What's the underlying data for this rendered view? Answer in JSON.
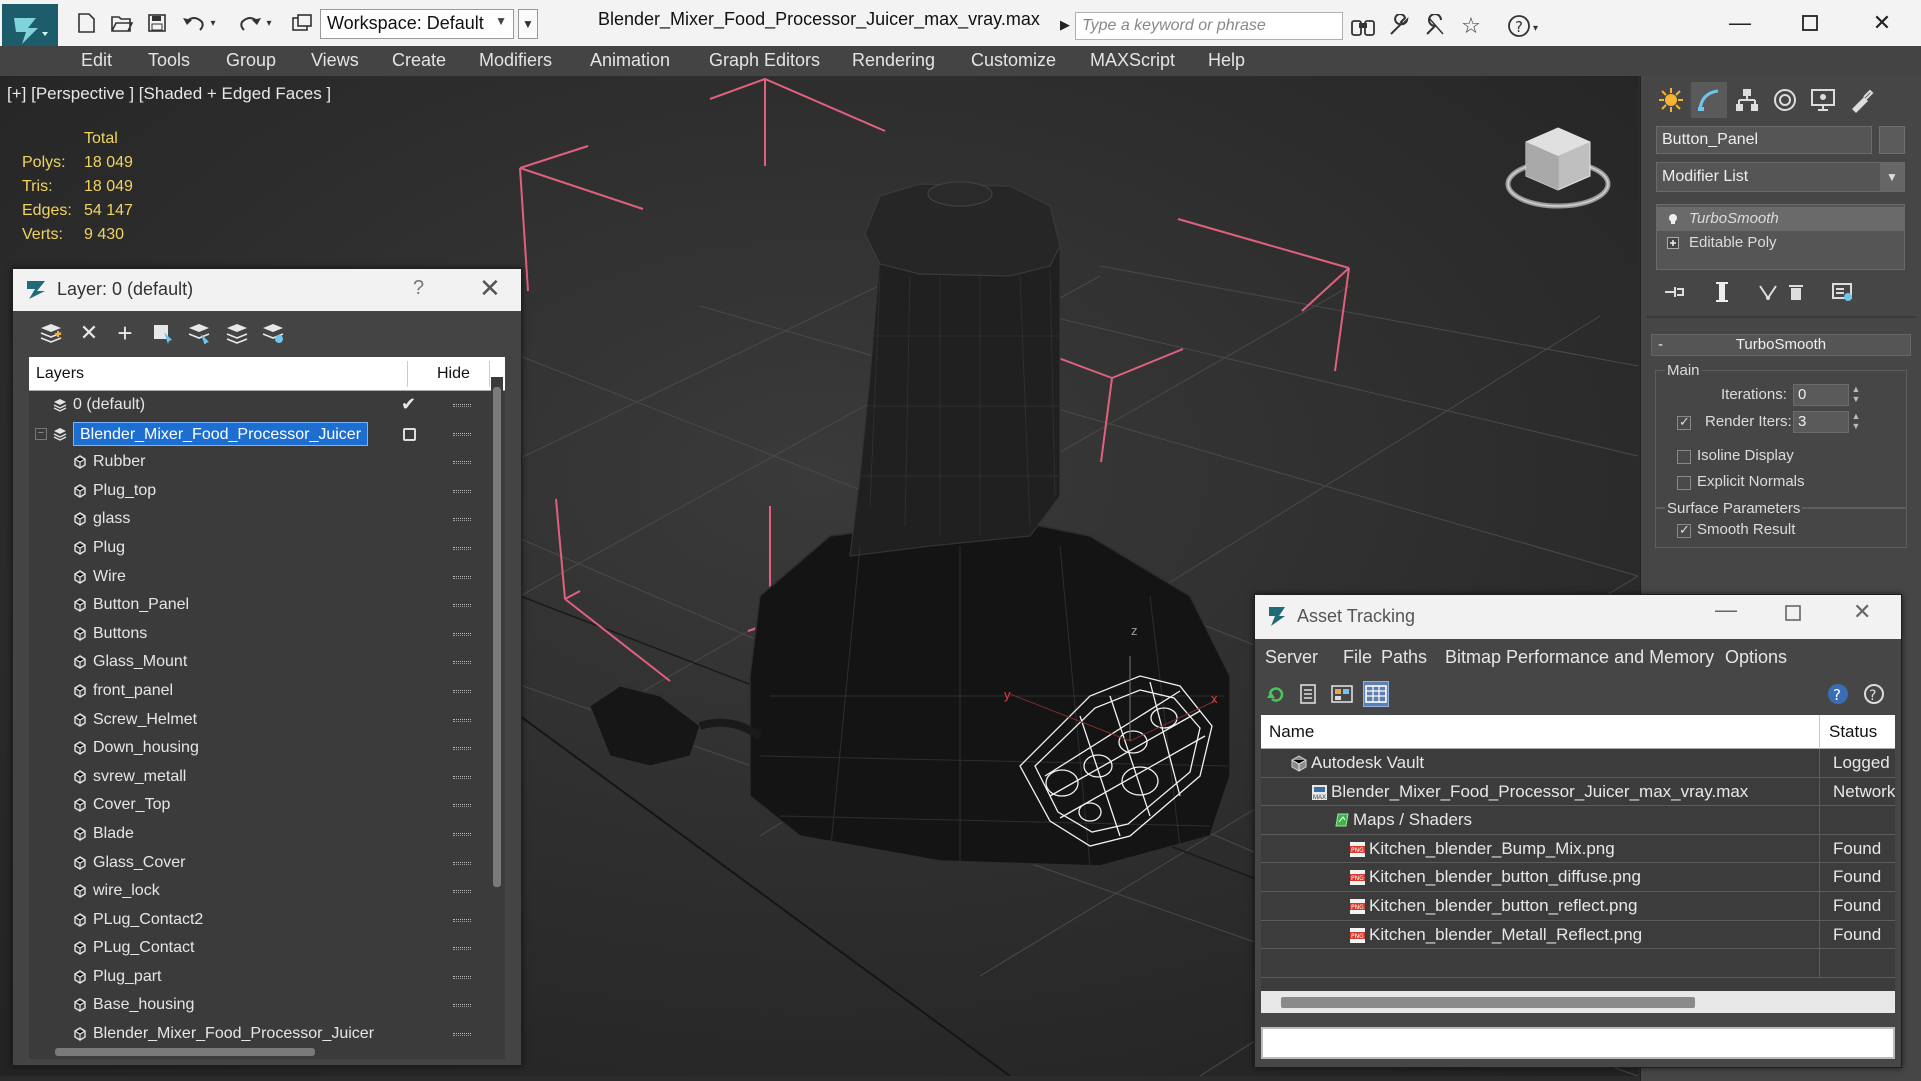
{
  "titlebar": {
    "workspace_label": "Workspace: Default",
    "file_title": "Blender_Mixer_Food_Processor_Juicer_max_vray.max",
    "search_placeholder": "Type a keyword or phrase"
  },
  "menu": [
    "Edit",
    "Tools",
    "Group",
    "Views",
    "Create",
    "Modifiers",
    "Animation",
    "Graph Editors",
    "Rendering",
    "Customize",
    "MAXScript",
    "Help"
  ],
  "viewport": {
    "label": "[+] [Perspective ] [Shaded + Edged Faces ]",
    "stats_header": "Total",
    "stats": [
      {
        "key": "Polys:",
        "value": "18 049"
      },
      {
        "key": "Tris:",
        "value": "18 049"
      },
      {
        "key": "Edges:",
        "value": "54 147"
      },
      {
        "key": "Verts:",
        "value": "9 430"
      }
    ],
    "axis_labels": {
      "x": "x",
      "y": "y",
      "z": "z"
    }
  },
  "command_panel": {
    "object_name": "Button_Panel",
    "modifier_list": "Modifier List",
    "stack": [
      "TurboSmooth",
      "Editable Poly"
    ],
    "rollout_title": "TurboSmooth",
    "main_group": "Main",
    "iterations_label": "Iterations:",
    "iterations_value": "0",
    "render_iters_label": "Render Iters:",
    "render_iters_value": "3",
    "render_iters_checked": true,
    "isoline_label": "Isoline Display",
    "explicit_normals_label": "Explicit Normals",
    "surface_group": "Surface Parameters",
    "smooth_result_label": "Smooth Result",
    "smooth_result_checked": true
  },
  "layer_explorer": {
    "title": "Layer: 0 (default)",
    "help": "?",
    "col_layers": "Layers",
    "col_hide": "Hide",
    "rows": [
      {
        "name": "0 (default)",
        "level": 0,
        "type": "layer"
      },
      {
        "name": "Blender_Mixer_Food_Processor_Juicer",
        "level": 0,
        "type": "layer-selected"
      },
      {
        "name": "Rubber",
        "level": 1,
        "type": "object"
      },
      {
        "name": "Plug_top",
        "level": 1,
        "type": "object"
      },
      {
        "name": "glass",
        "level": 1,
        "type": "object"
      },
      {
        "name": "Plug",
        "level": 1,
        "type": "object"
      },
      {
        "name": "Wire",
        "level": 1,
        "type": "object"
      },
      {
        "name": "Button_Panel",
        "level": 1,
        "type": "object"
      },
      {
        "name": "Buttons",
        "level": 1,
        "type": "object"
      },
      {
        "name": "Glass_Mount",
        "level": 1,
        "type": "object"
      },
      {
        "name": "front_panel",
        "level": 1,
        "type": "object"
      },
      {
        "name": "Screw_Helmet",
        "level": 1,
        "type": "object"
      },
      {
        "name": "Down_housing",
        "level": 1,
        "type": "object"
      },
      {
        "name": "svrew_metall",
        "level": 1,
        "type": "object"
      },
      {
        "name": "Cover_Top",
        "level": 1,
        "type": "object"
      },
      {
        "name": "Blade",
        "level": 1,
        "type": "object"
      },
      {
        "name": "Glass_Cover",
        "level": 1,
        "type": "object"
      },
      {
        "name": "wire_lock",
        "level": 1,
        "type": "object"
      },
      {
        "name": "PLug_Contact2",
        "level": 1,
        "type": "object"
      },
      {
        "name": "PLug_Contact",
        "level": 1,
        "type": "object"
      },
      {
        "name": "Plug_part",
        "level": 1,
        "type": "object"
      },
      {
        "name": "Base_housing",
        "level": 1,
        "type": "object"
      },
      {
        "name": "Blender_Mixer_Food_Processor_Juicer",
        "level": 1,
        "type": "object"
      }
    ]
  },
  "asset_tracking": {
    "title": "Asset Tracking",
    "menu": [
      "Server",
      "File",
      "Paths",
      "Bitmap Performance and Memory",
      "Options"
    ],
    "col_name": "Name",
    "col_status": "Status",
    "rows": [
      {
        "name": "Autodesk Vault",
        "status": "Logged O",
        "level": 0,
        "icon": "vault"
      },
      {
        "name": "Blender_Mixer_Food_Processor_Juicer_max_vray.max",
        "status": "Network",
        "level": 1,
        "icon": "max"
      },
      {
        "name": "Maps / Shaders",
        "status": "",
        "level": 2,
        "icon": "maps"
      },
      {
        "name": "Kitchen_blender_Bump_Mix.png",
        "status": "Found",
        "level": 3,
        "icon": "png"
      },
      {
        "name": "Kitchen_blender_button_diffuse.png",
        "status": "Found",
        "level": 3,
        "icon": "png"
      },
      {
        "name": "Kitchen_blender_button_reflect.png",
        "status": "Found",
        "level": 3,
        "icon": "png"
      },
      {
        "name": "Kitchen_blender_Metall_Reflect.png",
        "status": "Found",
        "level": 3,
        "icon": "png"
      },
      {
        "name": "",
        "status": "",
        "level": 0,
        "icon": ""
      }
    ]
  },
  "colors": {
    "accent_selection": "#1c6fd1",
    "bbox_pink": "#e0607f",
    "stats_yellow": "#f0d460"
  }
}
